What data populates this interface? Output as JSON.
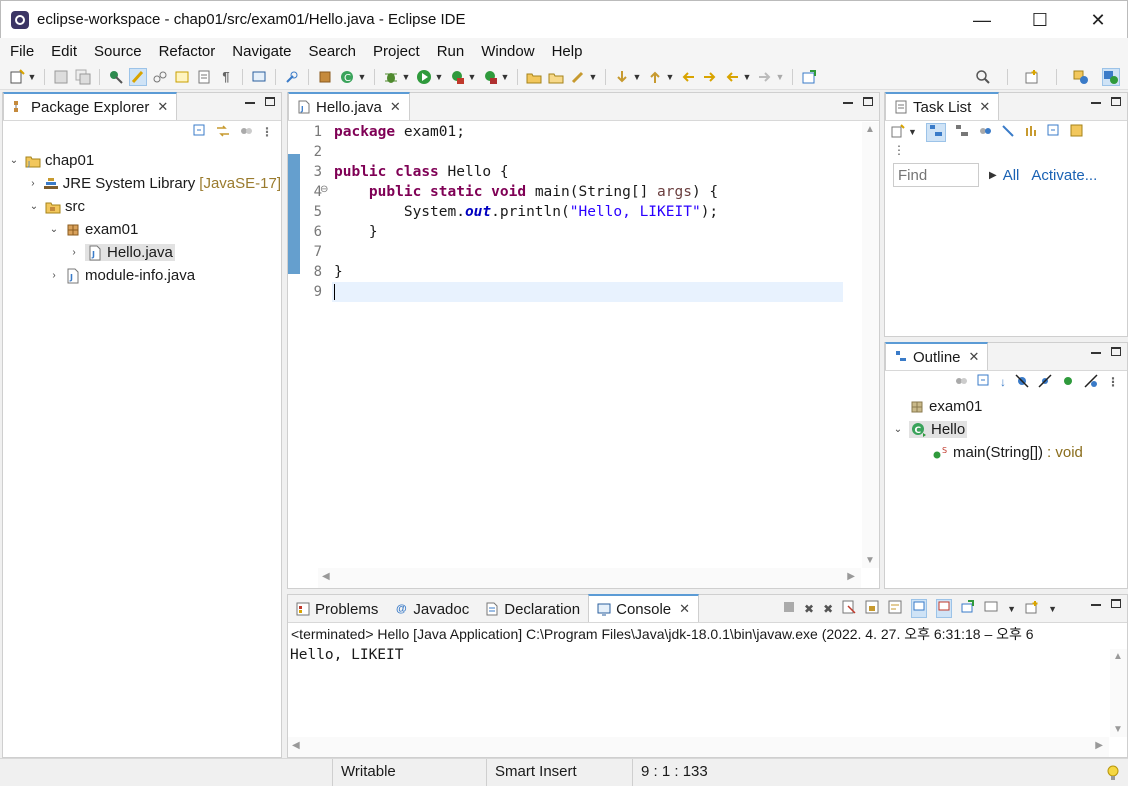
{
  "window": {
    "title": "eclipse-workspace - chap01/src/exam01/Hello.java - Eclipse IDE",
    "minimize": "—",
    "maximize": "☐",
    "close": "✕"
  },
  "menu": [
    "File",
    "Edit",
    "Source",
    "Refactor",
    "Navigate",
    "Search",
    "Project",
    "Run",
    "Window",
    "Help"
  ],
  "package_explorer": {
    "tab_label": "Package Explorer",
    "tree": {
      "project": "chap01",
      "jre_label": "JRE System Library",
      "jre_decor": "[JavaSE-17]",
      "src": "src",
      "package": "exam01",
      "file1": "Hello.java",
      "file2": "module-info.java"
    }
  },
  "editor": {
    "tab_label": "Hello.java",
    "line_numbers": [
      "1",
      "2",
      "3",
      "4",
      "5",
      "6",
      "7",
      "8",
      "9"
    ],
    "code": {
      "l1_kw": "package",
      "l1_rest": " exam01;",
      "l3_kw1": "public",
      "l3_kw2": "class",
      "l3_rest": " Hello {",
      "l4_kw1": "public",
      "l4_kw2": "static",
      "l4_kw3": "void",
      "l4_mid": " main(String[] ",
      "l4_param": "args",
      "l4_end": ") {",
      "l5_pre": "System.",
      "l5_field": "out",
      "l5_mid": ".println(",
      "l5_str": "\"Hello, LIKEIT\"",
      "l5_end": ");",
      "l6": "}",
      "l8": "}"
    }
  },
  "task_list": {
    "tab_label": "Task List",
    "find_placeholder": "Find",
    "all_link": "All",
    "activate_link": "Activate..."
  },
  "outline": {
    "tab_label": "Outline",
    "package": "exam01",
    "class": "Hello",
    "method": "main(String[])",
    "return_type": ": void"
  },
  "bottom_tabs": {
    "problems": "Problems",
    "javadoc": "Javadoc",
    "declaration": "Declaration",
    "console": "Console"
  },
  "console": {
    "info": "<terminated> Hello [Java Application] C:\\Program Files\\Java\\jdk-18.0.1\\bin\\javaw.exe  (2022. 4. 27. 오후 6:31:18 – 오후 6",
    "output": "Hello, LIKEIT"
  },
  "status": {
    "writable": "Writable",
    "insert_mode": "Smart Insert",
    "position": "9 : 1 : 133"
  }
}
